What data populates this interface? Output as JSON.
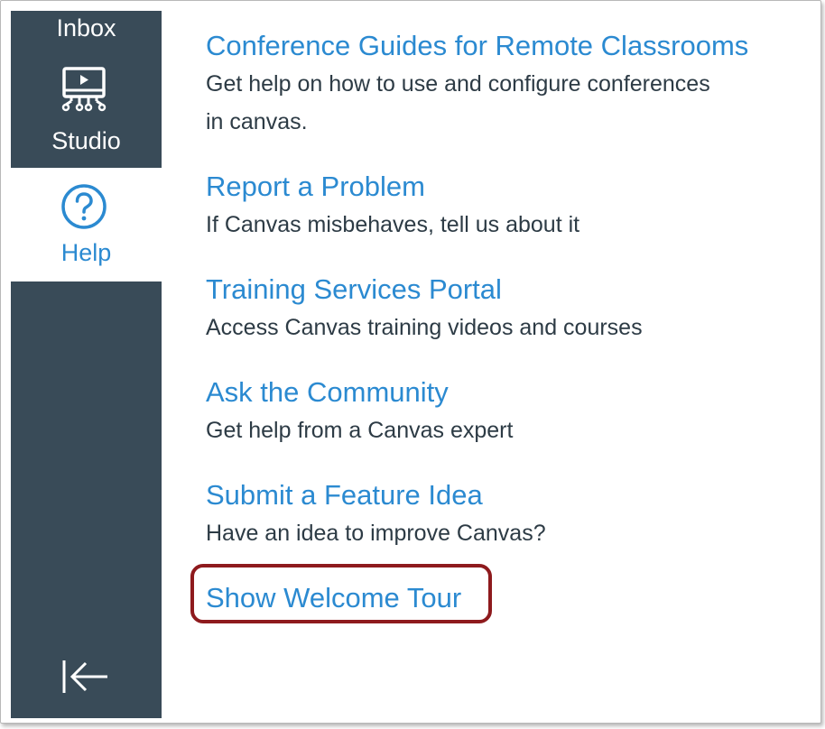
{
  "sidebar": {
    "inbox_label": "Inbox",
    "studio_label": "Studio",
    "help_label": "Help",
    "icons": {
      "studio": "studio-video-icon",
      "help": "question-circle-icon",
      "collapse": "arrow-left-bar-icon"
    }
  },
  "help_items": [
    {
      "title": "Conference Guides for Remote Classrooms",
      "description_line1": "Get help on how to use and configure conferences",
      "description_line2": "in canvas."
    },
    {
      "title": "Report a Problem",
      "description": "If Canvas misbehaves, tell us about it"
    },
    {
      "title": "Training Services Portal",
      "description": "Access Canvas training videos and courses"
    },
    {
      "title": "Ask the Community",
      "description": "Get help from a Canvas expert"
    },
    {
      "title": "Submit a Feature Idea",
      "description": "Have an idea to improve Canvas?"
    },
    {
      "title": "Show Welcome Tour"
    }
  ],
  "colors": {
    "sidebar_bg": "#394b58",
    "link": "#2b8ad1",
    "text": "#2d3b45",
    "highlight_border": "#8e1a1d"
  }
}
